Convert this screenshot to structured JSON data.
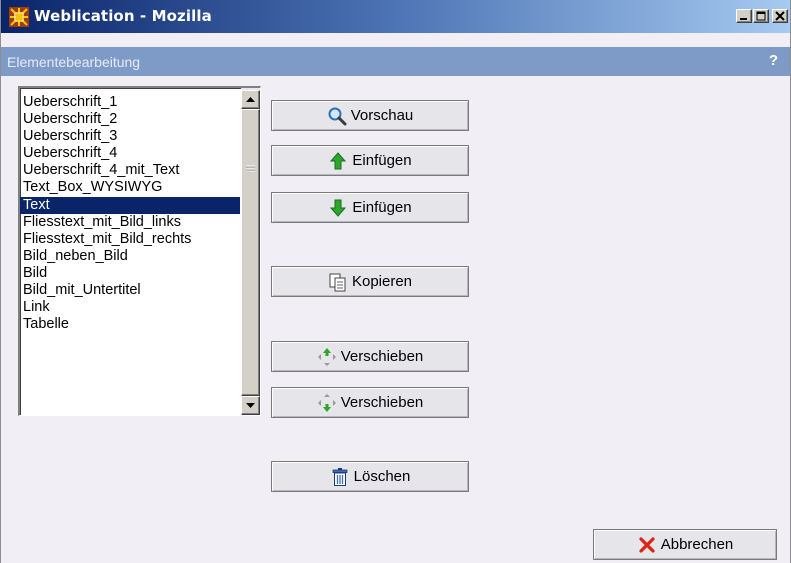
{
  "window": {
    "title": "Weblication - Mozilla"
  },
  "subheader": {
    "title": "Elementebearbeitung",
    "help": "?"
  },
  "list": {
    "items": [
      "Ueberschrift_1",
      "Ueberschrift_2",
      "Ueberschrift_3",
      "Ueberschrift_4",
      "Ueberschrift_4_mit_Text",
      "Text_Box_WYSIWYG",
      "Text",
      "Fliesstext_mit_Bild_links",
      "Fliesstext_mit_Bild_rechts",
      "Bild_neben_Bild",
      "Bild",
      "Bild_mit_Untertitel",
      "Link",
      "Tabelle"
    ],
    "selected": "Text"
  },
  "buttons": {
    "vorschau": "Vorschau",
    "einfuegen_oben": "Einfügen",
    "einfuegen_unten": "Einfügen",
    "kopieren": "Kopieren",
    "verschieben_oben": "Verschieben",
    "verschieben_unten": "Verschieben",
    "loeschen": "Löschen",
    "abbrechen": "Abbrechen"
  },
  "icons": {
    "app": "weblication-grid-icon",
    "vorschau": "magnifier-icon",
    "einfuegen_oben": "green-arrow-up-icon",
    "einfuegen_unten": "green-arrow-down-icon",
    "kopieren": "copy-icon",
    "verschieben_oben": "move-up-icon",
    "verschieben_unten": "move-down-icon",
    "loeschen": "trash-icon",
    "abbrechen": "red-x-icon"
  },
  "colors": {
    "titlebar_start": "#0a246a",
    "titlebar_end": "#a6caf0",
    "subheader": "#7e9bc8",
    "selection": "#0a246a",
    "background": "#f1eff5"
  }
}
